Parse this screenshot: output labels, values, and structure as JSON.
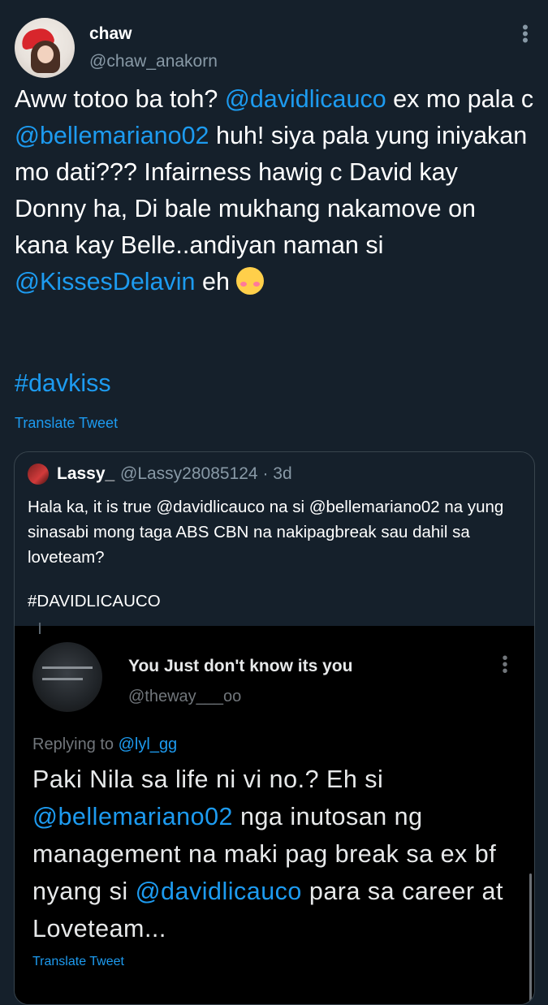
{
  "tweet": {
    "author_name": "chaw",
    "author_handle": "@chaw_anakorn",
    "more_icon": "more-vertical-icon",
    "text_segments": [
      {
        "t": "Aww totoo ba toh? ",
        "type": "text"
      },
      {
        "t": "@davidlicauco",
        "type": "mention"
      },
      {
        "t": " ex mo pala c ",
        "type": "text"
      },
      {
        "t": "@bellemariano02",
        "type": "mention"
      },
      {
        "t": "  huh! siya pala yung iniyakan mo dati??? Infairness hawig c David kay Donny ha, Di bale mukhang nakamove on kana kay Belle..andiyan naman si ",
        "type": "text"
      },
      {
        "t": "@KissesDelavin",
        "type": "mention"
      },
      {
        "t": " eh ",
        "type": "text"
      }
    ],
    "emoji": "smiling-face-with-blush-icon",
    "hashtag": "#davkiss",
    "translate_label": "Translate Tweet"
  },
  "quote": {
    "author_name": "Lassy_",
    "author_handle": "@Lassy28085124 · 3d",
    "text": "Hala ka, it is true @davidlicauco na si @bellemariano02 na yung sinasabi mong taga ABS CBN  na nakipagbreak sau dahil sa loveteam?",
    "hashtag": "#DAVIDLICAUCO",
    "embedded": {
      "author_name": "You Just don't know its you",
      "author_handle": "@theway___oo",
      "replying_prefix": "Replying to ",
      "replying_to": "@lyl_gg",
      "text_segments": [
        {
          "t": "Paki Nila sa life ni vi no.? Eh si ",
          "type": "text"
        },
        {
          "t": "@bellemariano02",
          "type": "mention"
        },
        {
          "t": "  nga inutosan ng management na maki pag break sa ex bf nyang si ",
          "type": "text"
        },
        {
          "t": "@davidlicauco",
          "type": "mention"
        },
        {
          "t": "  para sa career at Loveteam...",
          "type": "text"
        }
      ],
      "translate_label": "Translate Tweet"
    }
  },
  "colors": {
    "background": "#15202b",
    "link": "#1d9bf0",
    "secondary_text": "#8899a6"
  }
}
